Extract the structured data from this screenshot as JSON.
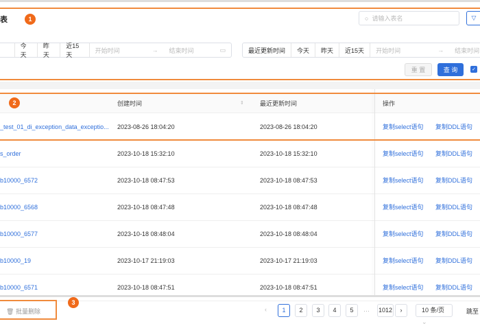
{
  "header": {
    "title": "表",
    "search_placeholder": "请输入表名"
  },
  "filters": {
    "group1": {
      "quick": [
        "今天",
        "昨天",
        "近15天"
      ],
      "start_placeholder": "开始时间",
      "end_placeholder": "结束时间"
    },
    "group2": {
      "label": "最近更新时间",
      "quick": [
        "今天",
        "昨天",
        "近15天"
      ],
      "start_placeholder": "开始时间",
      "end_placeholder": "结束时间"
    },
    "reset_label": "重 置",
    "query_label": "查 询"
  },
  "annotations": [
    "1",
    "2",
    "3"
  ],
  "table": {
    "columns": {
      "created": "创建时间",
      "updated": "最近更新时间",
      "ops": "操作"
    },
    "rows": [
      {
        "name": "_test_01_di_exception_data_exceptio...",
        "created": "2023-08-26 18:04:20",
        "updated": "2023-08-26 18:04:20"
      },
      {
        "name": "s_order",
        "created": "2023-10-18 15:32:10",
        "updated": "2023-10-18 15:32:10"
      },
      {
        "name": "b10000_6572",
        "created": "2023-10-18 08:47:53",
        "updated": "2023-10-18 08:47:53"
      },
      {
        "name": "b10000_6568",
        "created": "2023-10-18 08:47:48",
        "updated": "2023-10-18 08:47:48"
      },
      {
        "name": "b10000_6577",
        "created": "2023-10-18 08:48:04",
        "updated": "2023-10-18 08:48:04"
      },
      {
        "name": "b10000_19",
        "created": "2023-10-17 21:19:03",
        "updated": "2023-10-17 21:19:03"
      },
      {
        "name": "b10000_6571",
        "created": "2023-10-18 08:47:51",
        "updated": "2023-10-18 08:47:51"
      }
    ],
    "op_select": "复制select语句",
    "op_ddl": "复制DDL语句"
  },
  "footer": {
    "batch_delete": "批量删除",
    "pages": [
      "1",
      "2",
      "3",
      "4",
      "5"
    ],
    "ellipsis": "···",
    "last_page": "1012",
    "page_size": "10 条/页",
    "jump_label": "跳至"
  }
}
